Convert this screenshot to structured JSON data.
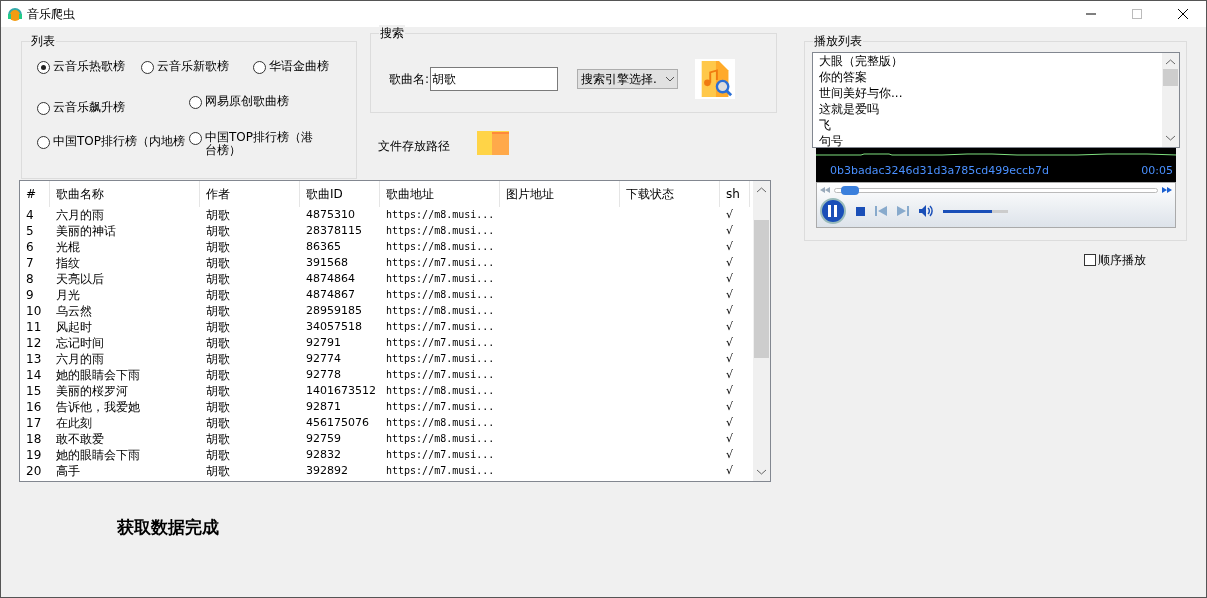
{
  "window": {
    "title": "音乐爬虫"
  },
  "list_group": {
    "title": "列表",
    "options": [
      {
        "label": "云音乐热歌榜",
        "selected": true
      },
      {
        "label": "云音乐新歌榜",
        "selected": false
      },
      {
        "label": "华语金曲榜",
        "selected": false
      },
      {
        "label": "云音乐飙升榜",
        "selected": false
      },
      {
        "label": "网易原创歌曲榜",
        "selected": false
      },
      {
        "label": "中国TOP排行榜（内地榜",
        "selected": false
      },
      {
        "label": "中国TOP排行榜（港台榜）",
        "selected": false
      }
    ]
  },
  "search_group": {
    "title": "搜索",
    "field_label": "歌曲名:",
    "field_value": "胡歌",
    "engine_select": "搜索引擎选择."
  },
  "file_path_label": "文件存放路径",
  "table": {
    "columns": [
      "#",
      "歌曲名称",
      "作者",
      "歌曲ID",
      "歌曲地址",
      "图片地址",
      "下载状态",
      "sh"
    ],
    "rows": [
      [
        "4",
        "六月的雨",
        "胡歌",
        "4875310",
        "https://m8.musi...",
        "√"
      ],
      [
        "5",
        "美丽的神话",
        "胡歌",
        "28378115",
        "https://m8.musi...",
        "√"
      ],
      [
        "6",
        "光棍",
        "胡歌",
        "86365",
        "https://m8.musi...",
        "√"
      ],
      [
        "7",
        "指纹",
        "胡歌",
        "391568",
        "https://m7.musi...",
        "√"
      ],
      [
        "8",
        "天亮以后",
        "胡歌",
        "4874864",
        "https://m7.musi...",
        "√"
      ],
      [
        "9",
        "月光",
        "胡歌",
        "4874867",
        "https://m8.musi...",
        "√"
      ],
      [
        "10",
        "乌云然",
        "胡歌",
        "28959185",
        "https://m8.musi...",
        "√"
      ],
      [
        "11",
        "风起时",
        "胡歌",
        "34057518",
        "https://m7.musi...",
        "√"
      ],
      [
        "12",
        "忘记时间",
        "胡歌",
        "92791",
        "https://m7.musi...",
        "√"
      ],
      [
        "13",
        "六月的雨",
        "胡歌",
        "92774",
        "https://m7.musi...",
        "√"
      ],
      [
        "14",
        "她的眼睛会下雨",
        "胡歌",
        "92778",
        "https://m7.musi...",
        "√"
      ],
      [
        "15",
        "美丽的桜罗河",
        "胡歌",
        "1401673512",
        "https://m8.musi...",
        "√"
      ],
      [
        "16",
        "告诉他，我爱她",
        "胡歌",
        "92871",
        "https://m7.musi...",
        "√"
      ],
      [
        "17",
        "在此刻",
        "胡歌",
        "456175076",
        "https://m8.musi...",
        "√"
      ],
      [
        "18",
        "敢不敢爱",
        "胡歌",
        "92759",
        "https://m8.musi...",
        "√"
      ],
      [
        "19",
        "她的眼睛会下雨",
        "胡歌",
        "92832",
        "https://m7.musi...",
        "√"
      ],
      [
        "20",
        "高手",
        "胡歌",
        "392892",
        "https://m7.musi...",
        "√"
      ]
    ]
  },
  "status": "获取数据完成",
  "playlist_group": {
    "title": "播放列表",
    "items": [
      "大眼（完整版）",
      "你的答案",
      "世间美好与你...",
      "这就是爱吗",
      "飞",
      "句号"
    ]
  },
  "player": {
    "track": "0b3badac3246d31d3a785cd499eccb7d",
    "time": "00:05",
    "playing": true,
    "seek": {
      "level": 0.03
    },
    "volume": {
      "level": 0.75
    }
  },
  "sequential_play": {
    "label": "顺序播放",
    "checked": false
  }
}
